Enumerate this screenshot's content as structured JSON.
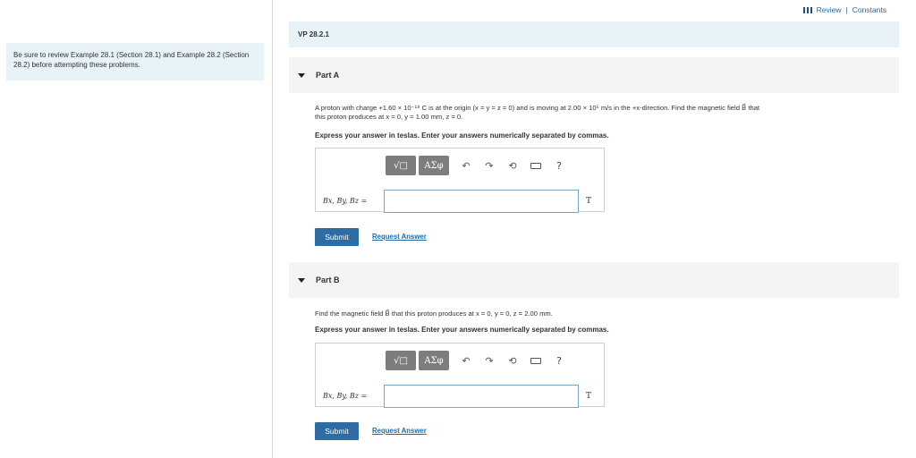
{
  "sidebar": {
    "note": "Be sure to review Example 28.1 (Section 28.1) and Example 28.2 (Section 28.2) before attempting these problems."
  },
  "topbar": {
    "review": "Review",
    "separator": "|",
    "constants": "Constants"
  },
  "problem": {
    "id": "VP 28.2.1"
  },
  "toolbar": {
    "templates_glyph": "√□",
    "greek_glyph": "ΑΣφ",
    "undo_glyph": "↶",
    "redo_glyph": "↷",
    "reset_glyph": "⟲",
    "help_glyph": "?"
  },
  "parts": [
    {
      "title": "Part A",
      "question_line1": "A proton with charge +1.60 × 10⁻¹⁹ C is at the origin (x = y = z = 0) and is moving at 2.00 × 10⁵ m/s in the +x-direction. Find the magnetic field B⃗ that",
      "question_line2": "this proton produces at x = 0, y = 1.00 mm, z = 0.",
      "instruction": "Express your answer in teslas. Enter your answers numerically separated by commas.",
      "answer_label": "Bx, By, Bz =",
      "answer_value": "",
      "unit": "T",
      "submit": "Submit",
      "request": "Request Answer"
    },
    {
      "title": "Part B",
      "question_line1": "Find the magnetic field B⃗ that this proton produces at x = 0, y = 0, z = 2.00 mm.",
      "instruction": "Express your answer in teslas. Enter your answers numerically separated by commas.",
      "answer_label": "Bx, By, Bz =",
      "answer_value": "",
      "unit": "T",
      "submit": "Submit",
      "request": "Request Answer"
    }
  ]
}
